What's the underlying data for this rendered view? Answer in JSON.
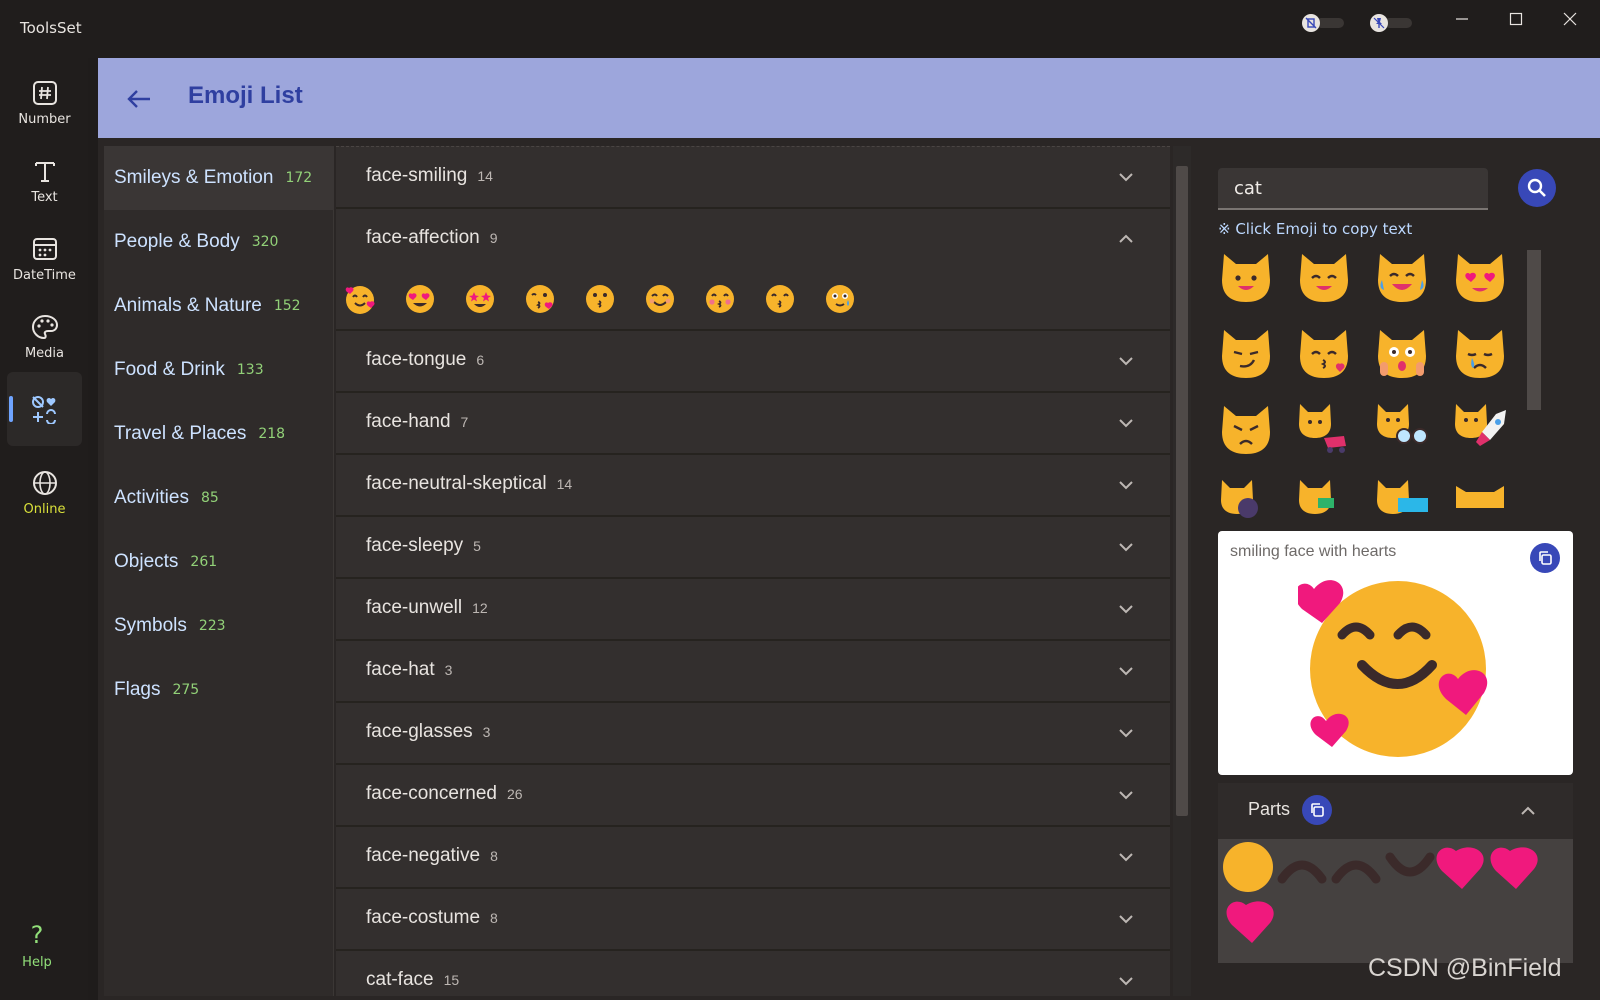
{
  "app": {
    "title": "ToolsSet"
  },
  "rail": {
    "items": [
      {
        "label": "Number",
        "icon": "hash-icon"
      },
      {
        "label": "Text",
        "icon": "text-t-icon"
      },
      {
        "label": "DateTime",
        "icon": "calendar-icon"
      },
      {
        "label": "Media",
        "icon": "palette-icon"
      },
      {
        "label": "",
        "icon": "shapes-icon"
      },
      {
        "label": "Online",
        "icon": "globe-icon"
      }
    ],
    "help_label": "Help"
  },
  "header": {
    "title": "Emoji List"
  },
  "categories": [
    {
      "name": "Smileys & Emotion",
      "count": "172"
    },
    {
      "name": "People & Body",
      "count": "320"
    },
    {
      "name": "Animals & Nature",
      "count": "152"
    },
    {
      "name": "Food & Drink",
      "count": "133"
    },
    {
      "name": "Travel & Places",
      "count": "218"
    },
    {
      "name": "Activities",
      "count": "85"
    },
    {
      "name": "Objects",
      "count": "261"
    },
    {
      "name": "Symbols",
      "count": "223"
    },
    {
      "name": "Flags",
      "count": "275"
    }
  ],
  "groups": [
    {
      "name": "face-smiling",
      "count": "14",
      "expanded": false
    },
    {
      "name": "face-affection",
      "count": "9",
      "expanded": true
    },
    {
      "name": "face-tongue",
      "count": "6",
      "expanded": false
    },
    {
      "name": "face-hand",
      "count": "7",
      "expanded": false
    },
    {
      "name": "face-neutral-skeptical",
      "count": "14",
      "expanded": false
    },
    {
      "name": "face-sleepy",
      "count": "5",
      "expanded": false
    },
    {
      "name": "face-unwell",
      "count": "12",
      "expanded": false
    },
    {
      "name": "face-hat",
      "count": "3",
      "expanded": false
    },
    {
      "name": "face-glasses",
      "count": "3",
      "expanded": false
    },
    {
      "name": "face-concerned",
      "count": "26",
      "expanded": false
    },
    {
      "name": "face-negative",
      "count": "8",
      "expanded": false
    },
    {
      "name": "face-costume",
      "count": "8",
      "expanded": false
    },
    {
      "name": "cat-face",
      "count": "15",
      "expanded": false
    }
  ],
  "search": {
    "value": "cat",
    "hint": "※ Click Emoji to copy text"
  },
  "detail": {
    "name": "smiling face with hearts"
  },
  "parts": {
    "title": "Parts"
  },
  "watermark": "CSDN @BinField",
  "colors": {
    "accent": "#3848b8",
    "header_band": "#9da6dc",
    "count_green": "#92d178",
    "category_text": "#cde2ff"
  }
}
